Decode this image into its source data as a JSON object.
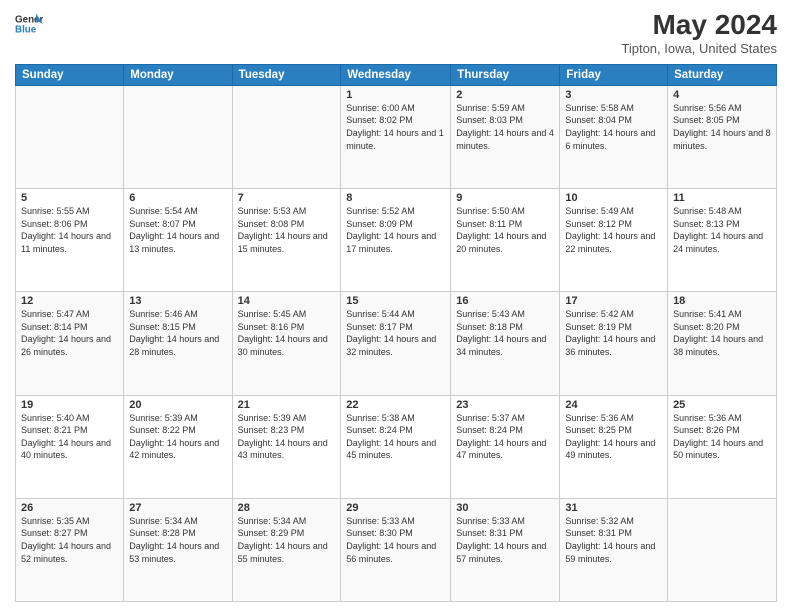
{
  "header": {
    "logo_line1": "General",
    "logo_line2": "Blue",
    "title": "May 2024",
    "subtitle": "Tipton, Iowa, United States"
  },
  "weekdays": [
    "Sunday",
    "Monday",
    "Tuesday",
    "Wednesday",
    "Thursday",
    "Friday",
    "Saturday"
  ],
  "weeks": [
    [
      {
        "day": "",
        "sunrise": "",
        "sunset": "",
        "daylight": ""
      },
      {
        "day": "",
        "sunrise": "",
        "sunset": "",
        "daylight": ""
      },
      {
        "day": "",
        "sunrise": "",
        "sunset": "",
        "daylight": ""
      },
      {
        "day": "1",
        "sunrise": "Sunrise: 6:00 AM",
        "sunset": "Sunset: 8:02 PM",
        "daylight": "Daylight: 14 hours and 1 minute."
      },
      {
        "day": "2",
        "sunrise": "Sunrise: 5:59 AM",
        "sunset": "Sunset: 8:03 PM",
        "daylight": "Daylight: 14 hours and 4 minutes."
      },
      {
        "day": "3",
        "sunrise": "Sunrise: 5:58 AM",
        "sunset": "Sunset: 8:04 PM",
        "daylight": "Daylight: 14 hours and 6 minutes."
      },
      {
        "day": "4",
        "sunrise": "Sunrise: 5:56 AM",
        "sunset": "Sunset: 8:05 PM",
        "daylight": "Daylight: 14 hours and 8 minutes."
      }
    ],
    [
      {
        "day": "5",
        "sunrise": "Sunrise: 5:55 AM",
        "sunset": "Sunset: 8:06 PM",
        "daylight": "Daylight: 14 hours and 11 minutes."
      },
      {
        "day": "6",
        "sunrise": "Sunrise: 5:54 AM",
        "sunset": "Sunset: 8:07 PM",
        "daylight": "Daylight: 14 hours and 13 minutes."
      },
      {
        "day": "7",
        "sunrise": "Sunrise: 5:53 AM",
        "sunset": "Sunset: 8:08 PM",
        "daylight": "Daylight: 14 hours and 15 minutes."
      },
      {
        "day": "8",
        "sunrise": "Sunrise: 5:52 AM",
        "sunset": "Sunset: 8:09 PM",
        "daylight": "Daylight: 14 hours and 17 minutes."
      },
      {
        "day": "9",
        "sunrise": "Sunrise: 5:50 AM",
        "sunset": "Sunset: 8:11 PM",
        "daylight": "Daylight: 14 hours and 20 minutes."
      },
      {
        "day": "10",
        "sunrise": "Sunrise: 5:49 AM",
        "sunset": "Sunset: 8:12 PM",
        "daylight": "Daylight: 14 hours and 22 minutes."
      },
      {
        "day": "11",
        "sunrise": "Sunrise: 5:48 AM",
        "sunset": "Sunset: 8:13 PM",
        "daylight": "Daylight: 14 hours and 24 minutes."
      }
    ],
    [
      {
        "day": "12",
        "sunrise": "Sunrise: 5:47 AM",
        "sunset": "Sunset: 8:14 PM",
        "daylight": "Daylight: 14 hours and 26 minutes."
      },
      {
        "day": "13",
        "sunrise": "Sunrise: 5:46 AM",
        "sunset": "Sunset: 8:15 PM",
        "daylight": "Daylight: 14 hours and 28 minutes."
      },
      {
        "day": "14",
        "sunrise": "Sunrise: 5:45 AM",
        "sunset": "Sunset: 8:16 PM",
        "daylight": "Daylight: 14 hours and 30 minutes."
      },
      {
        "day": "15",
        "sunrise": "Sunrise: 5:44 AM",
        "sunset": "Sunset: 8:17 PM",
        "daylight": "Daylight: 14 hours and 32 minutes."
      },
      {
        "day": "16",
        "sunrise": "Sunrise: 5:43 AM",
        "sunset": "Sunset: 8:18 PM",
        "daylight": "Daylight: 14 hours and 34 minutes."
      },
      {
        "day": "17",
        "sunrise": "Sunrise: 5:42 AM",
        "sunset": "Sunset: 8:19 PM",
        "daylight": "Daylight: 14 hours and 36 minutes."
      },
      {
        "day": "18",
        "sunrise": "Sunrise: 5:41 AM",
        "sunset": "Sunset: 8:20 PM",
        "daylight": "Daylight: 14 hours and 38 minutes."
      }
    ],
    [
      {
        "day": "19",
        "sunrise": "Sunrise: 5:40 AM",
        "sunset": "Sunset: 8:21 PM",
        "daylight": "Daylight: 14 hours and 40 minutes."
      },
      {
        "day": "20",
        "sunrise": "Sunrise: 5:39 AM",
        "sunset": "Sunset: 8:22 PM",
        "daylight": "Daylight: 14 hours and 42 minutes."
      },
      {
        "day": "21",
        "sunrise": "Sunrise: 5:39 AM",
        "sunset": "Sunset: 8:23 PM",
        "daylight": "Daylight: 14 hours and 43 minutes."
      },
      {
        "day": "22",
        "sunrise": "Sunrise: 5:38 AM",
        "sunset": "Sunset: 8:24 PM",
        "daylight": "Daylight: 14 hours and 45 minutes."
      },
      {
        "day": "23",
        "sunrise": "Sunrise: 5:37 AM",
        "sunset": "Sunset: 8:24 PM",
        "daylight": "Daylight: 14 hours and 47 minutes."
      },
      {
        "day": "24",
        "sunrise": "Sunrise: 5:36 AM",
        "sunset": "Sunset: 8:25 PM",
        "daylight": "Daylight: 14 hours and 49 minutes."
      },
      {
        "day": "25",
        "sunrise": "Sunrise: 5:36 AM",
        "sunset": "Sunset: 8:26 PM",
        "daylight": "Daylight: 14 hours and 50 minutes."
      }
    ],
    [
      {
        "day": "26",
        "sunrise": "Sunrise: 5:35 AM",
        "sunset": "Sunset: 8:27 PM",
        "daylight": "Daylight: 14 hours and 52 minutes."
      },
      {
        "day": "27",
        "sunrise": "Sunrise: 5:34 AM",
        "sunset": "Sunset: 8:28 PM",
        "daylight": "Daylight: 14 hours and 53 minutes."
      },
      {
        "day": "28",
        "sunrise": "Sunrise: 5:34 AM",
        "sunset": "Sunset: 8:29 PM",
        "daylight": "Daylight: 14 hours and 55 minutes."
      },
      {
        "day": "29",
        "sunrise": "Sunrise: 5:33 AM",
        "sunset": "Sunset: 8:30 PM",
        "daylight": "Daylight: 14 hours and 56 minutes."
      },
      {
        "day": "30",
        "sunrise": "Sunrise: 5:33 AM",
        "sunset": "Sunset: 8:31 PM",
        "daylight": "Daylight: 14 hours and 57 minutes."
      },
      {
        "day": "31",
        "sunrise": "Sunrise: 5:32 AM",
        "sunset": "Sunset: 8:31 PM",
        "daylight": "Daylight: 14 hours and 59 minutes."
      },
      {
        "day": "",
        "sunrise": "",
        "sunset": "",
        "daylight": ""
      }
    ]
  ]
}
